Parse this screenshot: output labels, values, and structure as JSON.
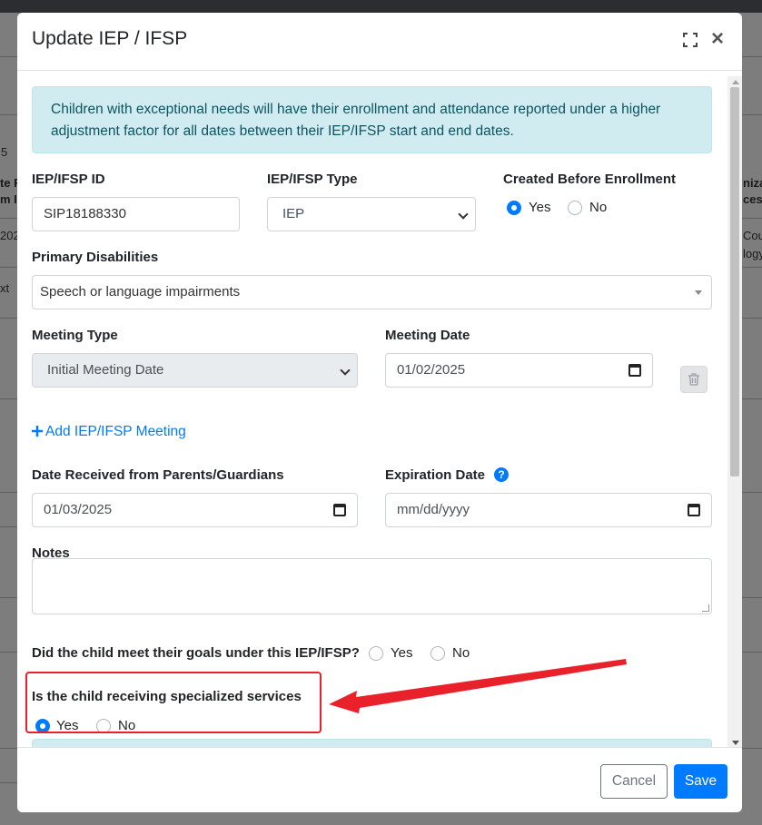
{
  "background": {
    "fragments": [
      "5",
      "te F",
      "m I",
      "202",
      "xt",
      "niza",
      "ces",
      "Cou",
      "logy"
    ]
  },
  "modal": {
    "title": "Update IEP / IFSP",
    "close_glyph": "×",
    "alert_text": "Children with exceptional needs will have their enrollment and attendance reported under a higher adjustment factor for all dates between their IEP/IFSP start and end dates.",
    "fields": {
      "iep_id_label": "IEP/IFSP ID",
      "iep_id_value": "SIP18188330",
      "iep_type_label": "IEP/IFSP Type",
      "iep_type_value": "IEP",
      "created_before_label": "Created Before Enrollment",
      "created_before_yes": "Yes",
      "created_before_no": "No",
      "created_before_selected": "Yes",
      "primary_disabilities_label": "Primary Disabilities",
      "primary_disabilities_value": "Speech or language impairments",
      "meeting_type_label": "Meeting Type",
      "meeting_type_value": "Initial Meeting Date",
      "meeting_date_label": "Meeting Date",
      "meeting_date_value": "01/02/2025",
      "add_meeting_label": "Add IEP/IFSP Meeting",
      "date_received_label": "Date Received from Parents/Guardians",
      "date_received_value": "01/03/2025",
      "expiration_label": "Expiration Date",
      "expiration_placeholder": "mm/dd/yyyy",
      "notes_label": "Notes",
      "notes_value": "",
      "goals_question": "Did the child meet their goals under this IEP/IFSP?",
      "goals_yes": "Yes",
      "goals_no": "No",
      "goals_selected": "",
      "services_question": "Is the child receiving specialized services",
      "services_yes": "Yes",
      "services_no": "No",
      "services_selected": "Yes"
    },
    "footer": {
      "cancel_label": "Cancel",
      "save_label": "Save"
    }
  },
  "colors": {
    "accent": "#007bff",
    "alert_bg": "#d1ecf1",
    "alert_text": "#0c5460",
    "annotation": "#e8212a"
  }
}
